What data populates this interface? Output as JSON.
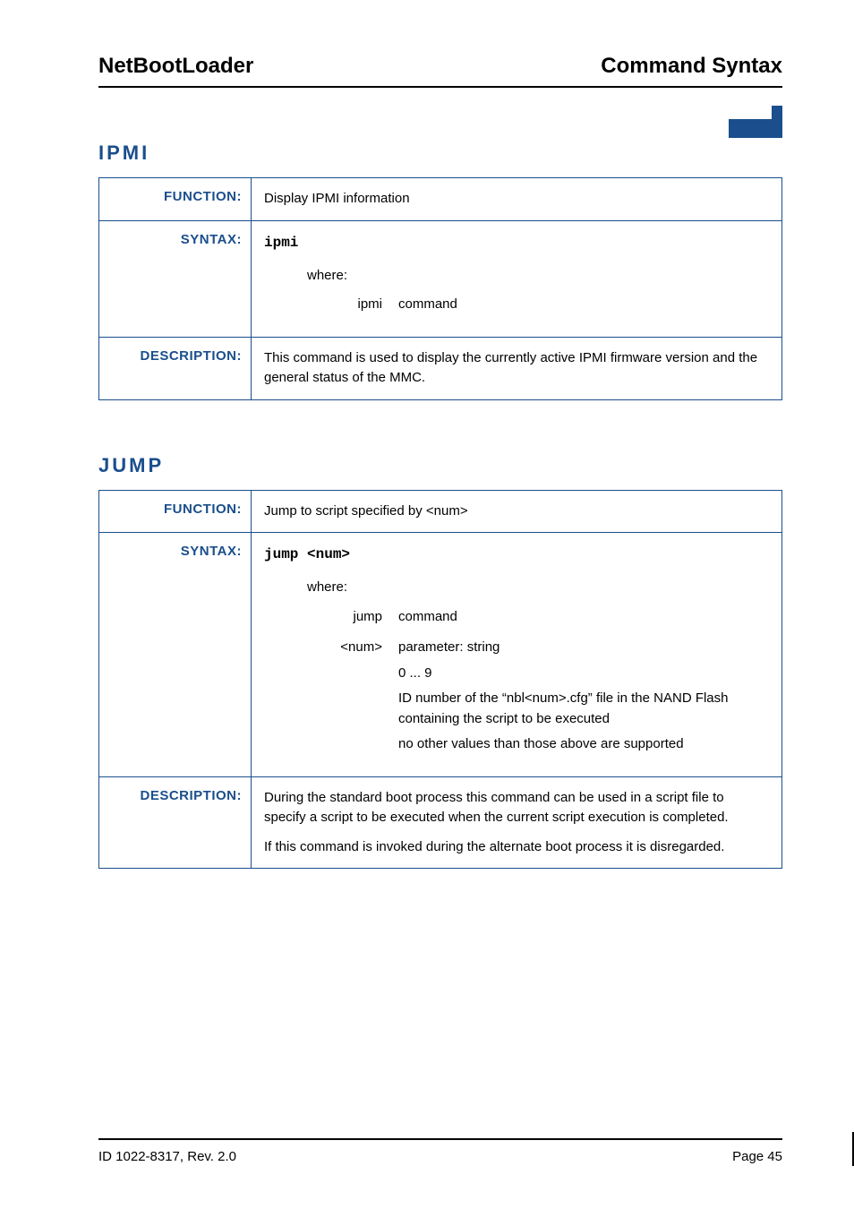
{
  "header": {
    "left": "NetBootLoader",
    "right": "Command Syntax"
  },
  "sections": {
    "ipmi": {
      "heading": "IPMI",
      "function_label": "FUNCTION:",
      "function_text": "Display IPMI information",
      "syntax_label": "SYNTAX:",
      "syntax_cmd": "ipmi",
      "where_label": "where:",
      "params": [
        {
          "name": "ipmi",
          "lines": [
            "command"
          ]
        }
      ],
      "description_label": "DESCRIPTION:",
      "description_paras": [
        "This command is used to display the currently active IPMI firmware version and the general status of the MMC."
      ]
    },
    "jump": {
      "heading": "JUMP",
      "function_label": "FUNCTION:",
      "function_text": "Jump to script specified by <num>",
      "syntax_label": "SYNTAX:",
      "syntax_cmd": "jump <num>",
      "where_label": "where:",
      "params": [
        {
          "name": "jump",
          "lines": [
            "command"
          ]
        },
        {
          "name": "<num>",
          "lines": [
            "parameter: string",
            "0 ... 9",
            "ID number of the “nbl<num>.cfg” file in the NAND Flash containing the script to be executed",
            "no other values than those above are supported"
          ]
        }
      ],
      "description_label": "DESCRIPTION:",
      "description_paras": [
        "During the standard boot process this command can be used in a script file to specify a script to be executed when the current script execution is completed.",
        "If this command is invoked during the alternate boot process it is disregarded."
      ]
    }
  },
  "footer": {
    "left": "ID 1022-8317, Rev. 2.0",
    "right": "Page 45"
  }
}
